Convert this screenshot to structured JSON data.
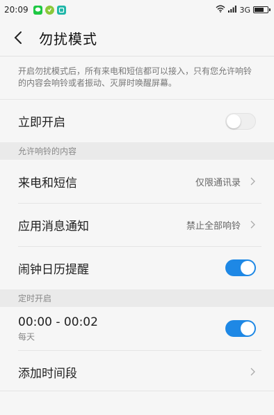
{
  "status_bar": {
    "time": "20:09",
    "network": "3G"
  },
  "header": {
    "title": "勿扰模式"
  },
  "description": "开启勿扰模式后，所有来电和短信都可以接入，只有您允许响铃的内容会响铃或者振动、灭屏时唤醒屏幕。",
  "immediate": {
    "label": "立即开启",
    "toggle_on": false
  },
  "allowed_section": {
    "header": "允许响铃的内容",
    "items": [
      {
        "label": "来电和短信",
        "value": "仅限通讯录"
      },
      {
        "label": "应用消息通知",
        "value": "禁止全部响铃"
      },
      {
        "label": "闹钟日历提醒",
        "toggle_on": true
      }
    ]
  },
  "schedule_section": {
    "header": "定时开启",
    "period": {
      "time": "00:00 - 00:02",
      "repeat": "每天",
      "toggle_on": true
    },
    "add_label": "添加时间段"
  },
  "colors": {
    "accent": "#1e88e5",
    "background": "#f6f6f6",
    "section_bg": "#eaeaea"
  }
}
